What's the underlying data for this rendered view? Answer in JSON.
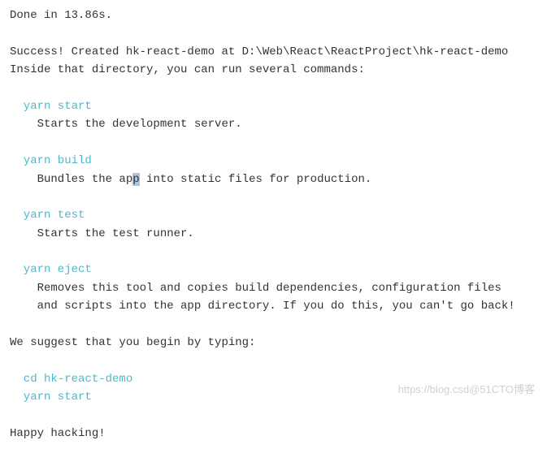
{
  "done": "Done in 13.86s.",
  "success": "Success! Created hk-react-demo at D:\\Web\\React\\ReactProject\\hk-react-demo",
  "inside": "Inside that directory, you can run several commands:",
  "cmd1": "  yarn start",
  "desc1": "    Starts the development server.",
  "cmd2": "  yarn build",
  "desc2a": "    Bundles the ap",
  "desc2hl": "p",
  "desc2b": " into static files for production.",
  "cmd3": "  yarn test",
  "desc3": "    Starts the test runner.",
  "cmd4": "  yarn eject",
  "desc4a": "    Removes this tool and copies build dependencies, configuration files",
  "desc4b": "    and scripts into the app directory. If you do this, you can't go back!",
  "suggest": "We suggest that you begin by typing:",
  "cd": "  cd hk-react-demo",
  "ys": "  yarn start",
  "happy": "Happy hacking!",
  "watermark": "https://blog.csd@51CTO博客"
}
